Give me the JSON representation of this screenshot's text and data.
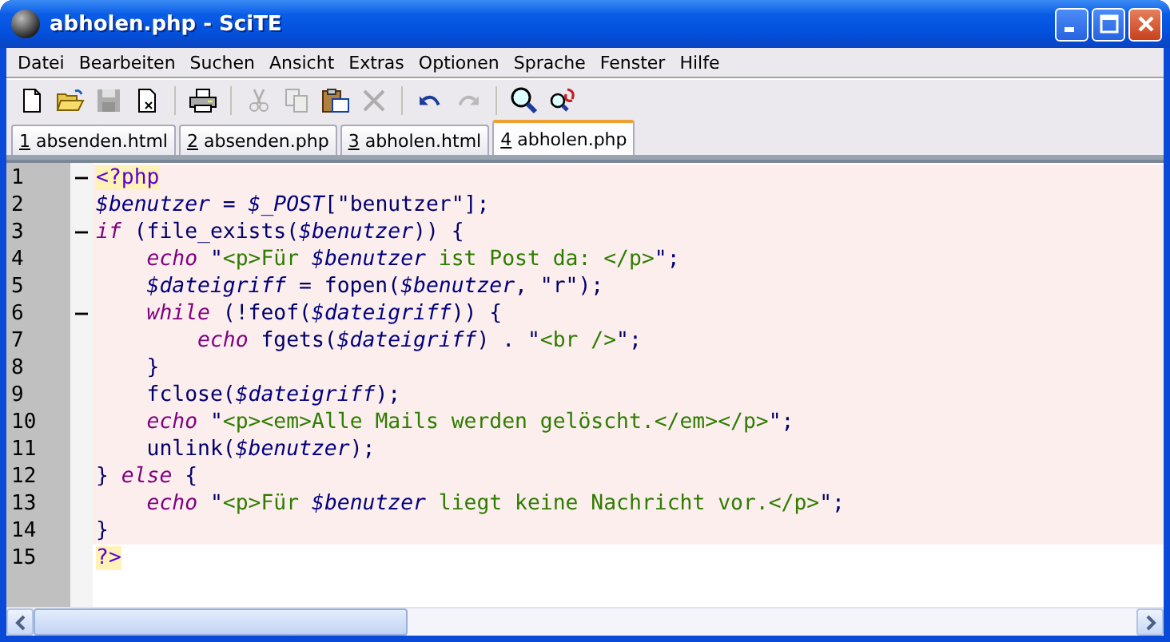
{
  "window": {
    "title": "abholen.php - SciTE"
  },
  "menu": [
    "Datei",
    "Bearbeiten",
    "Suchen",
    "Ansicht",
    "Extras",
    "Optionen",
    "Sprache",
    "Fenster",
    "Hilfe"
  ],
  "toolbar_groups": [
    [
      {
        "kind": "new",
        "disabled": false
      },
      {
        "kind": "open",
        "disabled": false
      },
      {
        "kind": "save",
        "disabled": true
      },
      {
        "kind": "close",
        "disabled": false
      }
    ],
    [
      {
        "kind": "print",
        "disabled": false
      }
    ],
    [
      {
        "kind": "cut",
        "disabled": true
      },
      {
        "kind": "copy",
        "disabled": true
      },
      {
        "kind": "paste",
        "disabled": false
      },
      {
        "kind": "delete",
        "disabled": true
      }
    ],
    [
      {
        "kind": "undo",
        "disabled": false
      },
      {
        "kind": "redo",
        "disabled": true
      }
    ],
    [
      {
        "kind": "find",
        "disabled": false
      },
      {
        "kind": "replace",
        "disabled": false
      }
    ]
  ],
  "tabs": [
    {
      "number": "1",
      "label": "absenden.html",
      "selected": false
    },
    {
      "number": "2",
      "label": "absenden.php",
      "selected": false
    },
    {
      "number": "3",
      "label": "abholen.html",
      "selected": false
    },
    {
      "number": "4",
      "label": "abholen.php",
      "selected": true
    }
  ],
  "lines": [
    {
      "number": "1",
      "fold": true,
      "embedded": true,
      "tokens": [
        {
          "kind": "tag",
          "text": "<?php"
        }
      ]
    },
    {
      "number": "2",
      "fold": false,
      "embedded": true,
      "tokens": [
        {
          "kind": "variable",
          "text": "$benutzer"
        },
        {
          "kind": "plain",
          "text": " = "
        },
        {
          "kind": "variable",
          "text": "$_POST"
        },
        {
          "kind": "plain",
          "text": "[\"benutzer\"];"
        }
      ]
    },
    {
      "number": "3",
      "fold": true,
      "embedded": true,
      "tokens": [
        {
          "kind": "keyword",
          "text": "if"
        },
        {
          "kind": "plain",
          "text": " (file_exists("
        },
        {
          "kind": "variable",
          "text": "$benutzer"
        },
        {
          "kind": "plain",
          "text": ")) {"
        }
      ]
    },
    {
      "number": "4",
      "fold": false,
      "embedded": true,
      "tokens": [
        {
          "kind": "keyword",
          "text": "    echo"
        },
        {
          "kind": "plain",
          "text": " \""
        },
        {
          "kind": "html",
          "text": "<p>Für "
        },
        {
          "kind": "variable",
          "text": "$benutzer"
        },
        {
          "kind": "html",
          "text": " ist Post da: </p>"
        },
        {
          "kind": "plain",
          "text": "\";"
        }
      ]
    },
    {
      "number": "5",
      "fold": false,
      "embedded": true,
      "tokens": [
        {
          "kind": "variable",
          "text": "    $dateigriff"
        },
        {
          "kind": "plain",
          "text": " = fopen("
        },
        {
          "kind": "variable",
          "text": "$benutzer"
        },
        {
          "kind": "plain",
          "text": ", \"r\");"
        }
      ]
    },
    {
      "number": "6",
      "fold": true,
      "embedded": true,
      "tokens": [
        {
          "kind": "keyword",
          "text": "    while"
        },
        {
          "kind": "plain",
          "text": " (!feof("
        },
        {
          "kind": "variable",
          "text": "$dateigriff"
        },
        {
          "kind": "plain",
          "text": ")) {"
        }
      ]
    },
    {
      "number": "7",
      "fold": false,
      "embedded": true,
      "tokens": [
        {
          "kind": "keyword",
          "text": "        echo"
        },
        {
          "kind": "plain",
          "text": " fgets("
        },
        {
          "kind": "variable",
          "text": "$dateigriff"
        },
        {
          "kind": "plain",
          "text": ") . \""
        },
        {
          "kind": "html",
          "text": "<br />"
        },
        {
          "kind": "plain",
          "text": "\";"
        }
      ]
    },
    {
      "number": "8",
      "fold": false,
      "embedded": true,
      "tokens": [
        {
          "kind": "plain",
          "text": "    }"
        }
      ]
    },
    {
      "number": "9",
      "fold": false,
      "embedded": true,
      "tokens": [
        {
          "kind": "plain",
          "text": "    fclose("
        },
        {
          "kind": "variable",
          "text": "$dateigriff"
        },
        {
          "kind": "plain",
          "text": ");"
        }
      ]
    },
    {
      "number": "10",
      "fold": false,
      "embedded": true,
      "tokens": [
        {
          "kind": "keyword",
          "text": "    echo"
        },
        {
          "kind": "plain",
          "text": " \""
        },
        {
          "kind": "html",
          "text": "<p><em>Alle Mails werden gelöscht.</em></p>"
        },
        {
          "kind": "plain",
          "text": "\";"
        }
      ]
    },
    {
      "number": "11",
      "fold": false,
      "embedded": true,
      "tokens": [
        {
          "kind": "plain",
          "text": "    unlink("
        },
        {
          "kind": "variable",
          "text": "$benutzer"
        },
        {
          "kind": "plain",
          "text": ");"
        }
      ]
    },
    {
      "number": "12",
      "fold": false,
      "embedded": true,
      "tokens": [
        {
          "kind": "plain",
          "text": "} "
        },
        {
          "kind": "keyword",
          "text": "else"
        },
        {
          "kind": "plain",
          "text": " {"
        }
      ]
    },
    {
      "number": "13",
      "fold": false,
      "embedded": true,
      "tokens": [
        {
          "kind": "keyword",
          "text": "    echo"
        },
        {
          "kind": "plain",
          "text": " \""
        },
        {
          "kind": "html",
          "text": "<p>Für "
        },
        {
          "kind": "variable",
          "text": "$benutzer"
        },
        {
          "kind": "html",
          "text": " liegt keine Nachricht vor.</p>"
        },
        {
          "kind": "plain",
          "text": "\";"
        }
      ]
    },
    {
      "number": "14",
      "fold": false,
      "embedded": true,
      "tokens": [
        {
          "kind": "plain",
          "text": "}"
        }
      ]
    },
    {
      "number": "15",
      "fold": false,
      "embedded": false,
      "tokens": [
        {
          "kind": "tag",
          "text": "?>"
        }
      ]
    }
  ]
}
